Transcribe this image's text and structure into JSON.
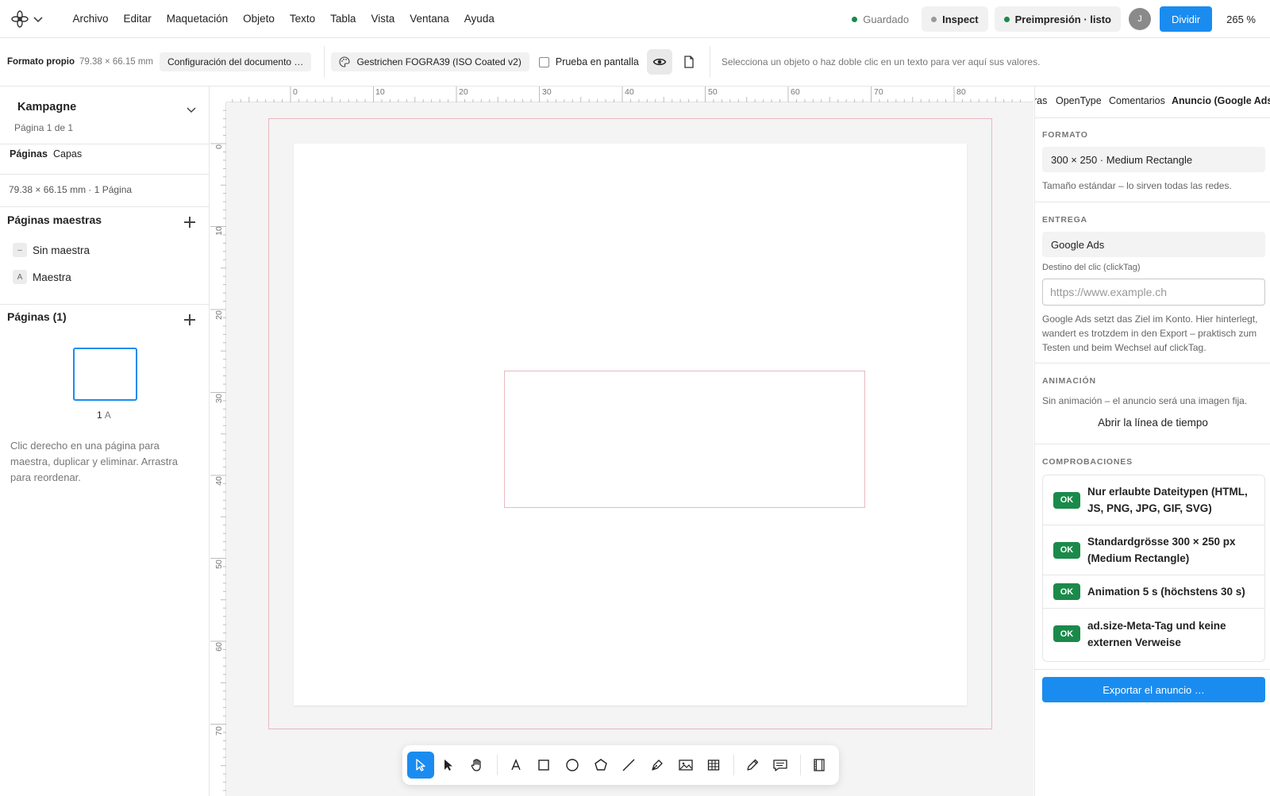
{
  "menubar": {
    "logo_icon": "flower-logo-icon",
    "items": [
      "Archivo",
      "Editar",
      "Maquetación",
      "Objeto",
      "Texto",
      "Tabla",
      "Vista",
      "Ventana",
      "Ayuda"
    ],
    "status_saved": "Guardado",
    "status_saved_color": "#1a8a4a",
    "inspect_label": "Inspect",
    "inspect_dot_color": "#9a9a9a",
    "preflight_label": "Preimpresión · listo",
    "preflight_dot_color": "#1a8a4a",
    "avatar_initial": "J",
    "share_label": "Dividir",
    "zoom": "265 %"
  },
  "optionsbar": {
    "format_label": "Formato propio",
    "dimensions": "79.38 × 66.15 mm",
    "doc_settings_label": "Configuración del documento …",
    "color_profile": "Gestrichen FOGRA39 (ISO Coated v2)",
    "softproof_label": "Prueba en pantalla",
    "hint": "Selecciona un objeto o haz doble clic en un texto para ver aquí sus valores."
  },
  "leftpanel": {
    "doc_title": "Kampagne",
    "doc_subtitle": "Página 1 de 1",
    "tabs": [
      "Páginas",
      "Capas"
    ],
    "size_info": "79.38 × 66.15 mm · 1 Página",
    "masters_title": "Páginas maestras",
    "masters": [
      {
        "badge": "–",
        "label": "Sin maestra"
      },
      {
        "badge": "A",
        "label": "Maestra"
      }
    ],
    "pages_title": "Páginas (1)",
    "page_number": "1",
    "page_master": "A",
    "help": "Clic derecho en una página para maestra, duplicar y eliminar. Arrastra para reordenar."
  },
  "rulers": {
    "top": [
      "0",
      "10",
      "20",
      "30",
      "40",
      "50",
      "60",
      "70",
      "80"
    ],
    "left": [
      "0",
      "10",
      "20",
      "30",
      "40",
      "50",
      "60",
      "70"
    ]
  },
  "toolbar": {
    "tools": [
      "select-arrow-icon",
      "direct-select-icon",
      "hand-icon",
      "text-tool-icon",
      "rectangle-icon",
      "ellipse-icon",
      "polygon-icon",
      "line-icon",
      "pen-icon",
      "image-icon",
      "table-icon",
      "pencil-icon",
      "notes-icon",
      "frame-icon"
    ]
  },
  "rightpanel": {
    "tabs": [
      "ras",
      "OpenType",
      "Comentarios",
      "Anuncio (Google Ads)"
    ],
    "format_head": "FORMATO",
    "format_value": "300 × 250 · Medium Rectangle",
    "format_note": "Tamaño estándar – lo sirven todas las redes.",
    "delivery_head": "ENTREGA",
    "delivery_value": "Google Ads",
    "clicktag_label": "Destino del clic (clickTag)",
    "clicktag_placeholder": "https://www.example.ch",
    "delivery_note": "Google Ads setzt das Ziel im Konto. Hier hinterlegt, wandert es trotzdem in den Export – praktisch zum Testen und beim Wechsel auf clickTag.",
    "animation_head": "ANIMACIÓN",
    "animation_note": "Sin animación – el anuncio será una imagen fija.",
    "timeline_link": "Abrir la línea de tiempo",
    "checks_head": "COMPROBACIONES",
    "checks": [
      {
        "status": "OK",
        "text": "Nur erlaubte Dateitypen (HTML, JS, PNG, JPG, GIF, SVG)"
      },
      {
        "status": "OK",
        "text": "Standardgrösse 300 × 250 px (Medium Rectangle)"
      },
      {
        "status": "OK",
        "text": "Animation 5 s (höchstens 30 s)"
      },
      {
        "status": "OK",
        "text": "ad.size-Meta-Tag und keine externen Verweise"
      }
    ],
    "export_label": "Exportar el anuncio …"
  }
}
